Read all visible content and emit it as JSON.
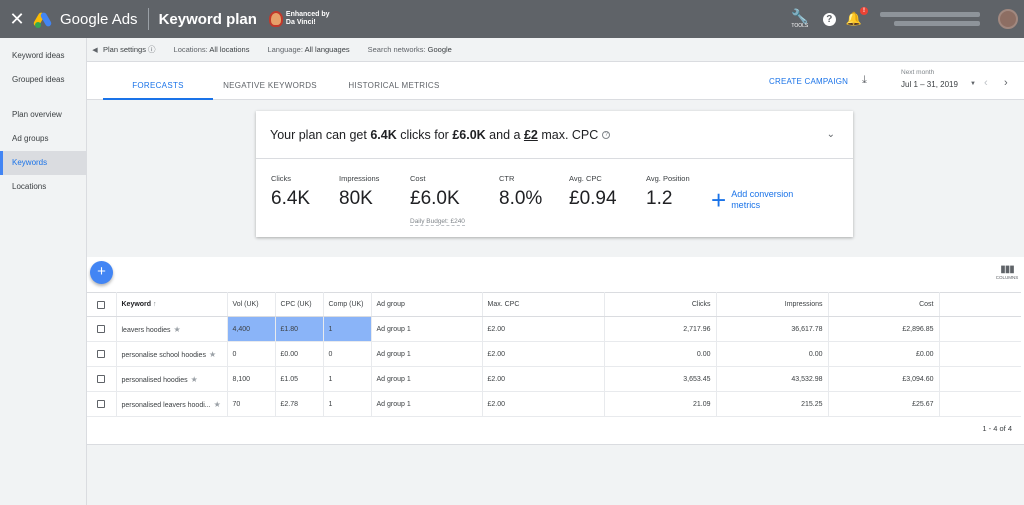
{
  "topbar": {
    "close_icon": "close-icon",
    "brand": "Google Ads",
    "title": "Keyword plan",
    "enhanced_line1": "Enhanced by",
    "enhanced_line2": "Da Vinci!",
    "tools_label": "TOOLS",
    "help": "?",
    "notification_badge": "!"
  },
  "sidebar": {
    "items": [
      {
        "label": "Keyword ideas",
        "active": false
      },
      {
        "label": "Grouped ideas",
        "active": false
      },
      {
        "label": "Plan overview",
        "active": false
      },
      {
        "label": "Ad groups",
        "active": false
      },
      {
        "label": "Keywords",
        "active": true
      },
      {
        "label": "Locations",
        "active": false
      }
    ]
  },
  "settings": {
    "plan_settings": "Plan settings",
    "locations_label": "Locations:",
    "locations_value": "All locations",
    "language_label": "Language:",
    "language_value": "All languages",
    "networks_label": "Search networks:",
    "networks_value": "Google"
  },
  "tabs": [
    "FORECASTS",
    "NEGATIVE KEYWORDS",
    "HISTORICAL METRICS"
  ],
  "header_actions": {
    "create_campaign": "CREATE CAMPAIGN",
    "next_month": "Next month",
    "date_range": "Jul 1 – 31, 2019"
  },
  "forecast": {
    "summary_prefix": "Your plan can get ",
    "summary_clicks": "6.4K",
    "summary_mid1": " clicks for ",
    "summary_cost": "£6.0K",
    "summary_mid2": " and a ",
    "summary_cpc": "£2",
    "summary_suffix": " max. CPC",
    "metrics": [
      {
        "label": "Clicks",
        "value": "6.4K"
      },
      {
        "label": "Impressions",
        "value": "80K"
      },
      {
        "label": "Cost",
        "value": "£6.0K",
        "sub": "Daily Budget: £240"
      },
      {
        "label": "CTR",
        "value": "8.0%"
      },
      {
        "label": "Avg. CPC",
        "value": "£0.94"
      },
      {
        "label": "Avg. Position",
        "value": "1.2"
      }
    ],
    "add_conversion_line1": "Add conversion",
    "add_conversion_line2": "metrics"
  },
  "table": {
    "columns_label": "COLUMNS",
    "headers": [
      "Keyword",
      "Vol (UK)",
      "CPC (UK)",
      "Comp (UK)",
      "Ad group",
      "Max. CPC",
      "Clicks",
      "Impressions",
      "Cost"
    ],
    "rows": [
      {
        "keyword": "leavers hoodies",
        "vol": "4,400",
        "cpc": "£1.80",
        "comp": "1",
        "adgroup": "Ad group 1",
        "maxcpc": "£2.00",
        "clicks": "2,717.96",
        "impressions": "36,617.78",
        "cost": "£2,896.85"
      },
      {
        "keyword": "personalise school hoodies",
        "vol": "0",
        "cpc": "£0.00",
        "comp": "0",
        "adgroup": "Ad group 1",
        "maxcpc": "£2.00",
        "clicks": "0.00",
        "impressions": "0.00",
        "cost": "£0.00"
      },
      {
        "keyword": "personalised hoodies",
        "vol": "8,100",
        "cpc": "£1.05",
        "comp": "1",
        "adgroup": "Ad group 1",
        "maxcpc": "£2.00",
        "clicks": "3,653.45",
        "impressions": "43,532.98",
        "cost": "£3,094.60"
      },
      {
        "keyword": "personalised leavers hoodi...",
        "vol": "70",
        "cpc": "£2.78",
        "comp": "1",
        "adgroup": "Ad group 1",
        "maxcpc": "£2.00",
        "clicks": "21.09",
        "impressions": "215.25",
        "cost": "£25.67"
      }
    ],
    "pagination": "1 - 4 of 4"
  },
  "colors": {
    "accent": "#1a73e8",
    "topbar": "#5f6368",
    "highlight": "#8ab4f8"
  }
}
